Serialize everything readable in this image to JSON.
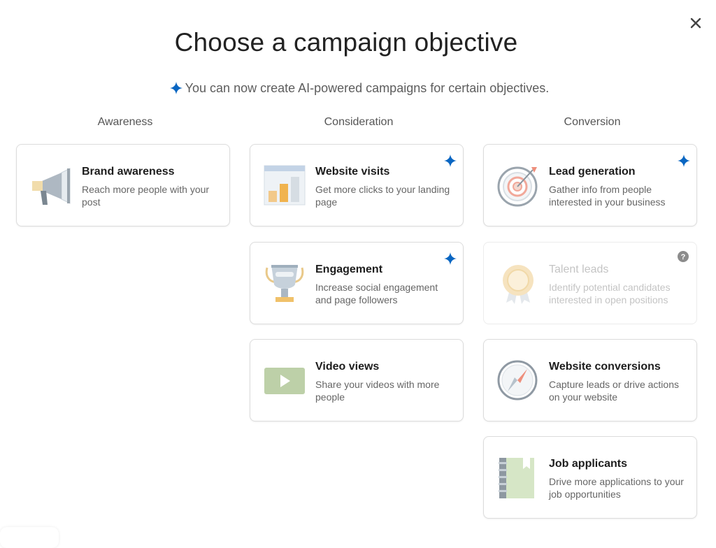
{
  "title": "Choose a campaign objective",
  "subtitle": "You can now create AI-powered campaigns for certain objectives.",
  "colors": {
    "ai_sparkle": "#0a66c2",
    "help_icon": "#8c8c8c"
  },
  "columns": [
    {
      "heading": "Awareness"
    },
    {
      "heading": "Consideration"
    },
    {
      "heading": "Conversion"
    }
  ],
  "cards": {
    "brand_awareness": {
      "title": "Brand awareness",
      "description": "Reach more people with your post",
      "icon": "megaphone-icon",
      "ai": false
    },
    "website_visits": {
      "title": "Website visits",
      "description": "Get more clicks to your landing page",
      "icon": "bar-chart-icon",
      "ai": true
    },
    "engagement": {
      "title": "Engagement",
      "description": "Increase social engagement and page followers",
      "icon": "trophy-icon",
      "ai": true
    },
    "video_views": {
      "title": "Video views",
      "description": "Share your videos with more people",
      "icon": "play-icon",
      "ai": false
    },
    "lead_generation": {
      "title": "Lead generation",
      "description": "Gather info from people interested in your business",
      "icon": "target-icon",
      "ai": true
    },
    "talent_leads": {
      "title": "Talent leads",
      "description": "Identify potential candidates interested in open positions",
      "icon": "rosette-icon",
      "ai": false,
      "disabled": true
    },
    "website_conversions": {
      "title": "Website conversions",
      "description": "Capture leads or drive actions on your website",
      "icon": "compass-icon",
      "ai": false
    },
    "job_applicants": {
      "title": "Job applicants",
      "description": "Drive more applications to your job opportunities",
      "icon": "notebook-icon",
      "ai": false
    }
  }
}
